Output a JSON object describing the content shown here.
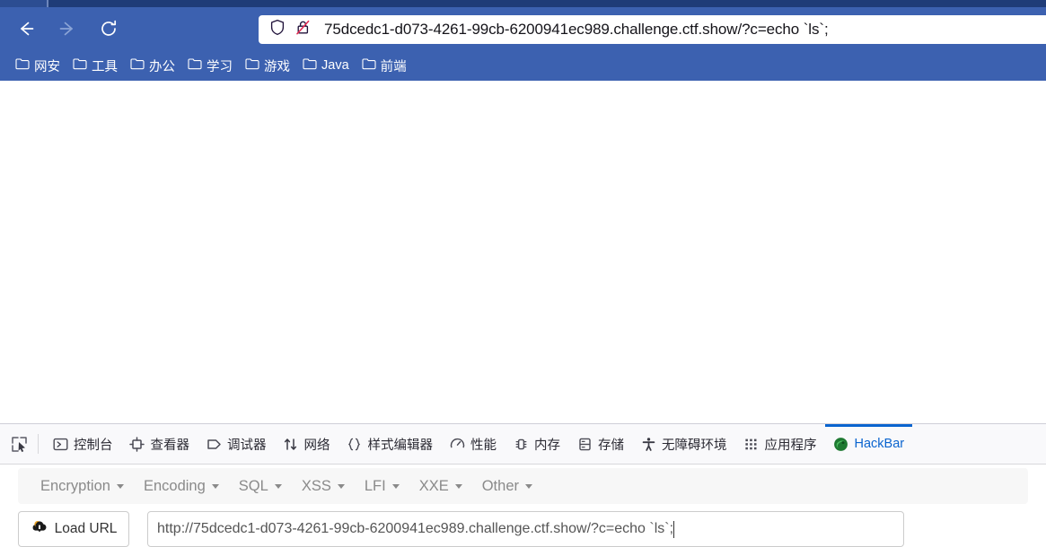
{
  "browser": {
    "nav": {
      "back": "back-arrow",
      "forward": "forward-arrow",
      "reload": "reload"
    },
    "urlbar": {
      "shield_icon": "shield-icon",
      "lock_icon": "broken-lock-icon",
      "url": "75dcedc1-d073-4261-99cb-6200941ec989.challenge.ctf.show/?c=echo `ls`;",
      "domain_bold": "challenge.ctf.show"
    },
    "bookmarks": [
      {
        "label": "网安",
        "icon": "folder-icon"
      },
      {
        "label": "工具",
        "icon": "folder-icon"
      },
      {
        "label": "办公",
        "icon": "folder-icon"
      },
      {
        "label": "学习",
        "icon": "folder-icon"
      },
      {
        "label": "游戏",
        "icon": "folder-icon"
      },
      {
        "label": "Java",
        "icon": "folder-icon"
      },
      {
        "label": "前端",
        "icon": "folder-icon"
      }
    ],
    "page_content": ""
  },
  "devtools": {
    "picker": "element-picker-icon",
    "tabs": [
      {
        "label": "控制台",
        "icon": "console-icon",
        "active": false
      },
      {
        "label": "查看器",
        "icon": "inspector-icon",
        "active": false
      },
      {
        "label": "调试器",
        "icon": "debugger-icon",
        "active": false
      },
      {
        "label": "网络",
        "icon": "network-icon",
        "active": false
      },
      {
        "label": "样式编辑器",
        "icon": "style-editor-icon",
        "active": false
      },
      {
        "label": "性能",
        "icon": "performance-icon",
        "active": false
      },
      {
        "label": "内存",
        "icon": "memory-icon",
        "active": false
      },
      {
        "label": "存储",
        "icon": "storage-icon",
        "active": false
      },
      {
        "label": "无障碍环境",
        "icon": "accessibility-icon",
        "active": false
      },
      {
        "label": "应用程序",
        "icon": "application-icon",
        "active": false
      },
      {
        "label": "HackBar",
        "icon": "hackbar-icon",
        "active": true
      }
    ]
  },
  "hackbar": {
    "menus": [
      {
        "label": "Encryption"
      },
      {
        "label": "Encoding"
      },
      {
        "label": "SQL"
      },
      {
        "label": "XSS"
      },
      {
        "label": "LFI"
      },
      {
        "label": "XXE"
      },
      {
        "label": "Other"
      }
    ],
    "load_url_label": "Load URL",
    "load_url_icon": "cloud-download-icon",
    "url_value": "http://75dcedc1-d073-4261-99cb-6200941ec989.challenge.ctf.show/?c=echo `ls`;"
  },
  "colors": {
    "chrome_blue": "#3c61b0",
    "tabstrip_navy": "#1f3c78",
    "accent_blue": "#0a64cf",
    "hackbar_green": "#2e8b3d"
  }
}
